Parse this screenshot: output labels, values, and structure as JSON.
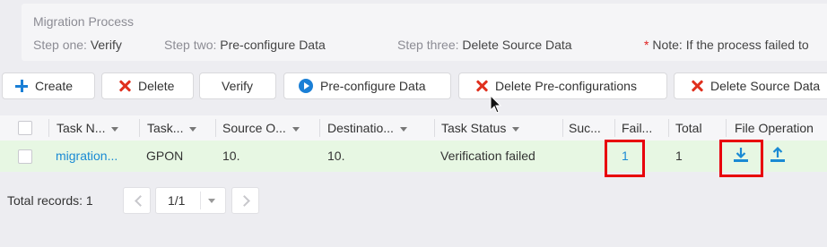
{
  "process": {
    "title": "Migration Process",
    "steps": [
      {
        "label": "Step one:",
        "value": "Verify"
      },
      {
        "label": "Step two:",
        "value": "Pre-configure Data"
      },
      {
        "label": "Step three:",
        "value": "Delete Source Data"
      }
    ],
    "note_asterisk": "*",
    "note": "Note: If the process failed to"
  },
  "toolbar": {
    "create": "Create",
    "delete": "Delete",
    "verify": "Verify",
    "preconfigure": "Pre-configure Data",
    "delete_preconfigurations": "Delete Pre-configurations",
    "delete_source_data": "Delete Source Data"
  },
  "table": {
    "columns": [
      "Task N...",
      "Task...",
      "Source O...",
      "Destinatio...",
      "Task Status",
      "Suc...",
      "Fail...",
      "Total",
      "File Operation"
    ],
    "row": {
      "task_name": "migration...",
      "task_type": "GPON",
      "source": "10.",
      "destination": "10.",
      "status": "Verification failed",
      "success": "",
      "failed": "1",
      "total": "1"
    }
  },
  "pager": {
    "total_label": "Total records: 1",
    "page": "1/1"
  },
  "colors": {
    "accent": "#1a7fd6",
    "danger": "#e0301e",
    "row_highlight": "#e7f7e3",
    "callout": "#e8000b"
  },
  "icons": [
    "plus-icon",
    "delete-x-icon",
    "play-circle-icon",
    "download-icon",
    "upload-icon",
    "chevron-left-icon",
    "chevron-right-icon",
    "dropdown-caret-icon",
    "mouse-cursor-icon"
  ]
}
